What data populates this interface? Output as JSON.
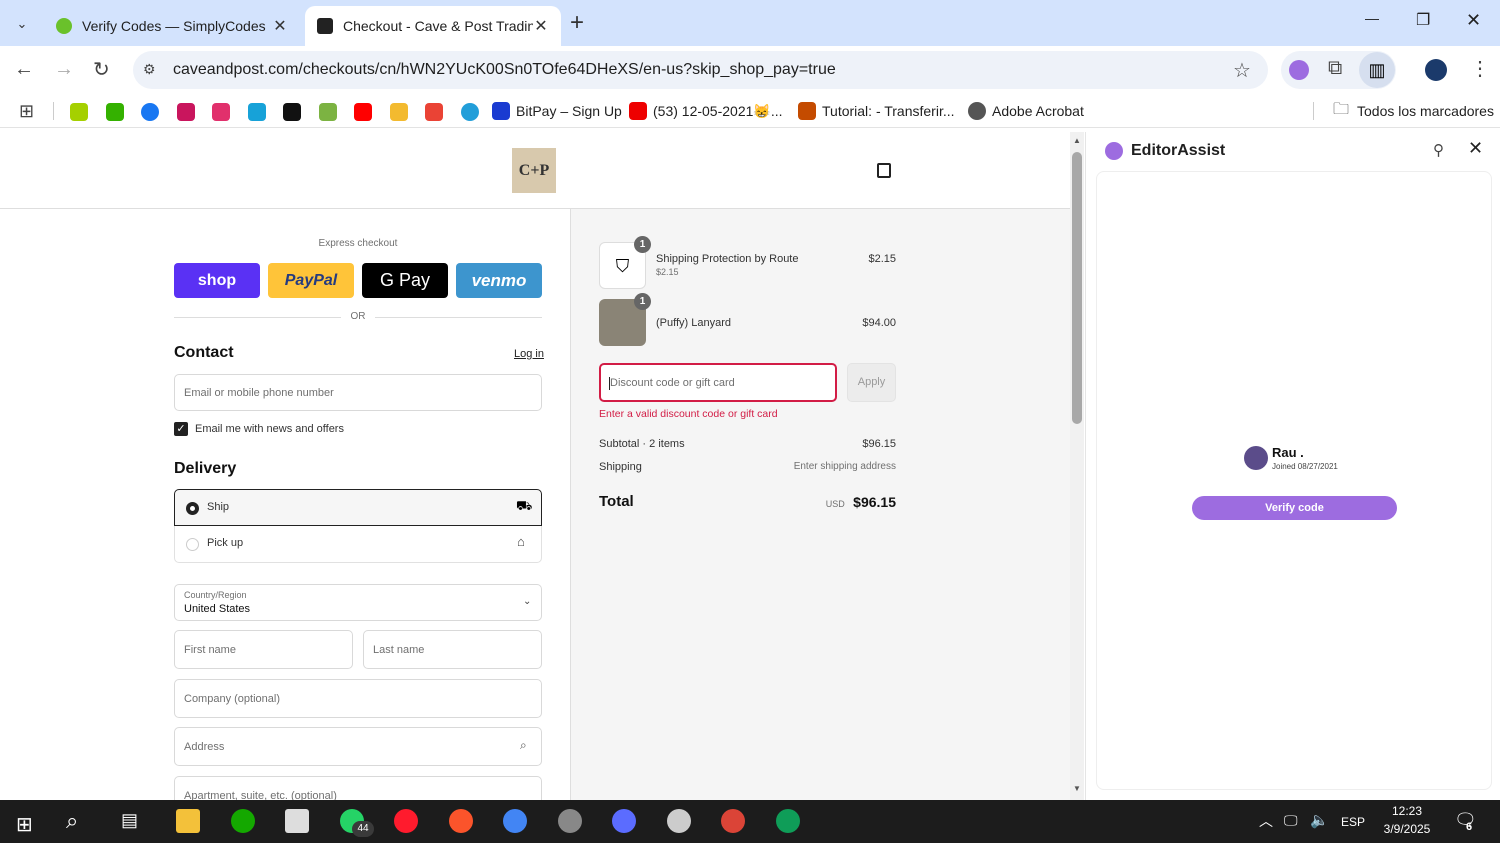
{
  "browser": {
    "tabs": [
      {
        "title": "Verify Codes — SimplyCodes",
        "close": "✕"
      },
      {
        "title": "Checkout - Cave & Post Trading",
        "close": "✕"
      }
    ],
    "new_tab": "+",
    "url": "caveandpost.com/checkouts/cn/hWN2YUcK00Sn0TOfe64DHeXS/en-us?skip_shop_pay=true",
    "window_controls": {
      "minimize": "—",
      "maximize": "❐",
      "close": "✕"
    },
    "bookmarks": [
      {
        "label": "BitPay – Sign Up",
        "color": "#1a3bd1"
      },
      {
        "label": "(53) 12-05-2021😸...",
        "color": "#e00"
      },
      {
        "label": "Tutorial: - Transferir...",
        "color": "#c44b00"
      },
      {
        "label": "Adobe Acrobat",
        "color": "#555"
      }
    ],
    "all_bookmarks": "Todos los marcadores",
    "icon_colors": [
      "#a5d000",
      "#34b100",
      "#1877f2",
      "#c9155d",
      "#e1306c",
      "#17a2d8",
      "#111",
      "#7cb342",
      "#ff0000",
      "#f3ba2f",
      "#ea4335",
      "#229ed9"
    ]
  },
  "checkout": {
    "logo_text": "C+P",
    "express_label": "Express checkout",
    "pay_buttons": {
      "shop": "shop",
      "paypal": "PayPal",
      "gpay": "G Pay",
      "venmo": "venmo"
    },
    "or_label": "OR",
    "contact": {
      "heading": "Contact",
      "login": "Log in",
      "email_placeholder": "Email or mobile phone number",
      "newsletter": "Email me with news and offers"
    },
    "delivery": {
      "heading": "Delivery",
      "ship": "Ship",
      "pickup": "Pick up",
      "country_label": "Country/Region",
      "country_value": "United States",
      "first_name": "First name",
      "last_name": "Last name",
      "company": "Company (optional)",
      "address": "Address",
      "apartment": "Apartment, suite, etc. (optional)"
    },
    "summary": {
      "items": [
        {
          "name": "Shipping Protection by Route",
          "sub": "$2.15",
          "price": "$2.15",
          "qty": "1"
        },
        {
          "name": "(Puffy) Lanyard",
          "sub": "",
          "price": "$94.00",
          "qty": "1"
        }
      ],
      "discount_placeholder": "Discount code or gift card",
      "apply": "Apply",
      "error": "Enter a valid discount code or gift card",
      "subtotal_label": "Subtotal · 2 items",
      "subtotal_value": "$96.15",
      "shipping_label": "Shipping",
      "shipping_value": "Enter shipping address",
      "total_label": "Total",
      "currency": "USD",
      "total_value": "$96.15"
    }
  },
  "sidepanel": {
    "title": "EditorAssist",
    "user_name": "Rau .",
    "joined": "Joined 08/27/2021",
    "verify_button": "Verify code"
  },
  "taskbar": {
    "whatsapp_badge": "44",
    "lang": "ESP",
    "time": "12:23",
    "date": "3/9/2025",
    "notif_count": "6"
  }
}
